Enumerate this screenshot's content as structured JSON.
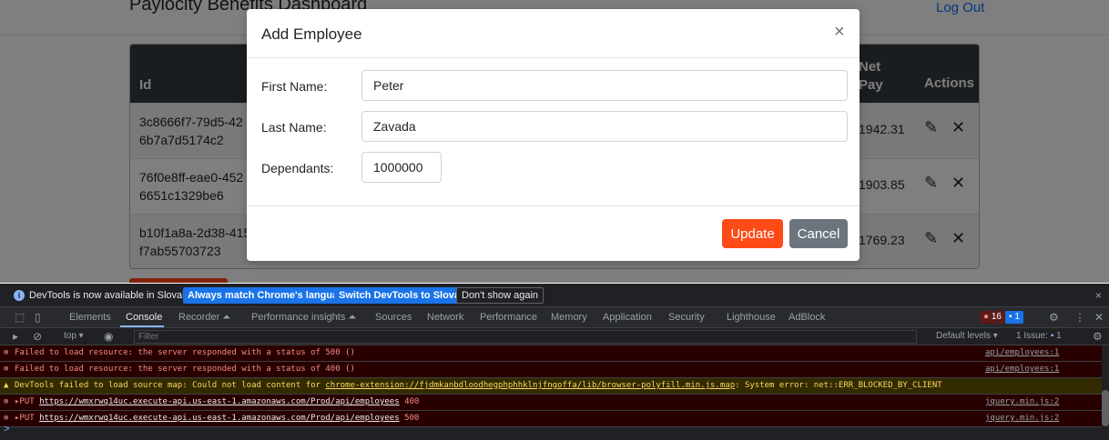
{
  "page": {
    "title": "Paylocity Benefits Dashboard",
    "logout": "Log Out",
    "columns": {
      "id": "Id",
      "net_pay_1": "Net",
      "net_pay_2": "Pay",
      "actions": "Actions"
    },
    "rows": [
      {
        "id_1": "3c8666f7-79d5-42",
        "id_2": "6b7a7d5174c2",
        "net_pay": "1942.31"
      },
      {
        "id_1": "76f0e8ff-eae0-452",
        "id_2": "6651c1329be6",
        "net_pay": "1903.85"
      },
      {
        "id_1": "b10f1a8a-2d38-415",
        "id_2": "f7ab55703723",
        "net_pay": "1769.23"
      }
    ]
  },
  "modal": {
    "title": "Add Employee",
    "close": "×",
    "first_name_label": "First Name:",
    "first_name_value": "Peter",
    "last_name_label": "Last Name:",
    "last_name_value": "Zavada",
    "dependants_label": "Dependants:",
    "dependants_value": "1000000",
    "update_label": "Update",
    "cancel_label": "Cancel"
  },
  "devtools": {
    "infobar": {
      "text": "DevTools is now available in Slovak!",
      "match_btn": "Always match Chrome's language",
      "switch_btn": "Switch DevTools to Slovak",
      "dismiss_btn": "Don't show again"
    },
    "tabs": [
      "Elements",
      "Console",
      "Recorder ⏶",
      "Performance insights ⏶",
      "Sources",
      "Network",
      "Performance",
      "Memory",
      "Application",
      "Security",
      "Lighthouse",
      "AdBlock"
    ],
    "error_count": "16",
    "message_count": "1",
    "context": "top ▾",
    "filter_placeholder": "Filter",
    "default_levels": "Default levels ▾",
    "issues": "1 Issue:",
    "issues_count": "1",
    "logs": [
      {
        "level": "error",
        "text": "Failed to load resource: the server responded with a status of 500 ()",
        "source": "api/employees:1"
      },
      {
        "level": "error",
        "text": "Failed to load resource: the server responded with a status of 400 ()",
        "source": "api/employees:1"
      },
      {
        "level": "warning",
        "prefix": "DevTools failed to load source map: Could not load content for ",
        "url": "chrome-extension://fjdmkanbdloodhegphphhklnjfngoffa/lib/browser-polyfill.min.js.map",
        "suffix": ": System error: net::ERR_BLOCKED_BY_CLIENT"
      },
      {
        "level": "error",
        "prefix": "▸PUT ",
        "url": "https://wmxrwq14uc.execute-api.us-east-1.amazonaws.com/Prod/api/employees",
        "suffix": " 400",
        "source": "jquery.min.js:2"
      },
      {
        "level": "error",
        "prefix": "▸PUT ",
        "url": "https://wmxrwq14uc.execute-api.us-east-1.amazonaws.com/Prod/api/employees",
        "suffix": " 500",
        "source": "jquery.min.js:2"
      }
    ],
    "prompt": ">"
  },
  "colors": {
    "accent": "#fd4a17",
    "secondary": "#6c757d",
    "table_header": "#343a40",
    "devtools_bg": "#202124"
  }
}
